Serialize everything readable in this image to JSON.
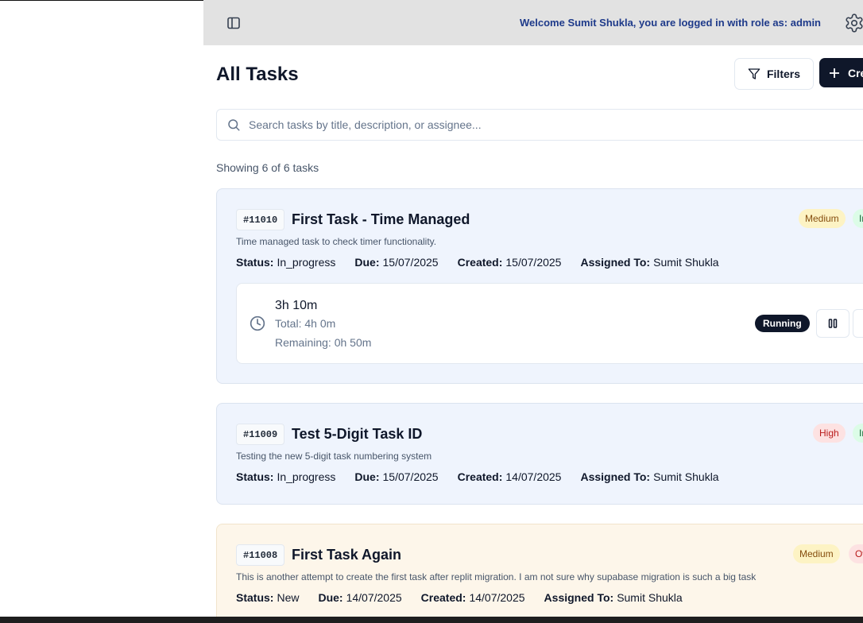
{
  "header": {
    "welcome": "Welcome Sumit Shukla, you are logged in with role as: admin"
  },
  "page": {
    "title": "All Tasks",
    "filters_label": "Filters",
    "create_label": "Create Task",
    "search_placeholder": "Search tasks by title, description, or assignee...",
    "showing": "Showing 6 of 6 tasks"
  },
  "meta_labels": {
    "status": "Status:",
    "due": "Due:",
    "created": "Created:",
    "assigned": "Assigned To:"
  },
  "tasks": [
    {
      "id": "#11010",
      "title": "First Task - Time Managed",
      "description": "Time managed task to check timer functionality.",
      "status": "In_progress",
      "due": "15/07/2025",
      "created": "15/07/2025",
      "assigned_to": "Sumit Shukla",
      "priority": "Medium",
      "second_badge": "In Progress",
      "timer": {
        "elapsed": "3h 10m",
        "total": "Total: 4h 0m",
        "remaining": "Remaining: 0h 50m",
        "state": "Running"
      }
    },
    {
      "id": "#11009",
      "title": "Test 5-Digit Task ID",
      "description": "Testing the new 5-digit task numbering system",
      "status": "In_progress",
      "due": "15/07/2025",
      "created": "14/07/2025",
      "assigned_to": "Sumit Shukla",
      "priority": "High",
      "second_badge": "In Progress"
    },
    {
      "id": "#11008",
      "title": "First Task Again",
      "description": "This is another attempt to create the first task after replit migration. I am not sure why supabase migration is such a big task",
      "status": "New",
      "due": "14/07/2025",
      "created": "14/07/2025",
      "assigned_to": "Sumit Shukla",
      "priority": "Medium",
      "second_badge": "Overdue"
    }
  ],
  "colors": {
    "header_bg": "#e2e2e2",
    "welcome_text": "#1e3a8a",
    "primary_button": "#0f172a",
    "card_bg": "#eff4fd",
    "overdue_card_bg": "#fdf6ea"
  }
}
